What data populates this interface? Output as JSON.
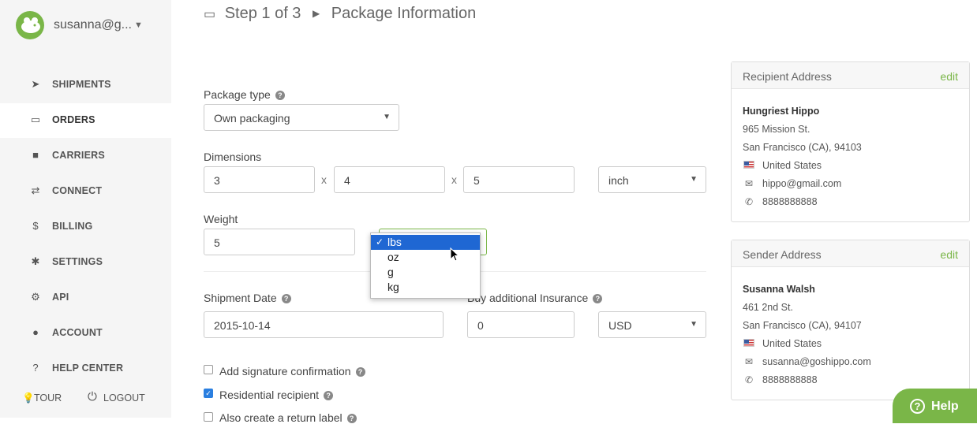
{
  "sidebar": {
    "user": "susanna@g...",
    "nav": [
      {
        "label": "SHIPMENTS",
        "icon": "paper-plane-icon"
      },
      {
        "label": "ORDERS",
        "icon": "inbox-icon"
      },
      {
        "label": "CARRIERS",
        "icon": "truck-icon"
      },
      {
        "label": "CONNECT",
        "icon": "exchange-icon"
      },
      {
        "label": "BILLING",
        "icon": "dollar-icon"
      },
      {
        "label": "SETTINGS",
        "icon": "gear-icon"
      },
      {
        "label": "API",
        "icon": "gears-icon"
      },
      {
        "label": "ACCOUNT",
        "icon": "user-icon"
      },
      {
        "label": "HELP CENTER",
        "icon": "question-icon"
      }
    ],
    "tour": "TOUR",
    "logout": "LOGOUT"
  },
  "header": {
    "step": "Step 1 of 3",
    "page": "Package Information"
  },
  "form": {
    "package_type_label": "Package type",
    "package_type_value": "Own packaging",
    "dimensions_label": "Dimensions",
    "dim_length": "3",
    "dim_width": "4",
    "dim_height": "5",
    "dim_sep": "x",
    "dim_unit": "inch",
    "weight_label": "Weight",
    "weight_value": "5",
    "weight_unit_options": [
      "lbs",
      "oz",
      "g",
      "kg"
    ],
    "weight_unit_selected": "lbs",
    "shipment_date_label": "Shipment Date",
    "shipment_date_value": "2015-10-14",
    "insurance_label": "Buy additional Insurance",
    "insurance_value": "0",
    "currency": "USD",
    "cb_signature": "Add signature confirmation",
    "cb_residential": "Residential recipient",
    "cb_return": "Also create a return label"
  },
  "recipient": {
    "title": "Recipient Address",
    "edit": "edit",
    "name": "Hungriest Hippo",
    "street": "965 Mission St.",
    "city": "San Francisco (CA), 94103",
    "country": "United States",
    "email": "hippo@gmail.com",
    "phone": "8888888888"
  },
  "sender": {
    "title": "Sender Address",
    "edit": "edit",
    "name": "Susanna Walsh",
    "street": "461 2nd St.",
    "city": "San Francisco (CA), 94107",
    "country": "United States",
    "email": "susanna@goshippo.com",
    "phone": "8888888888"
  },
  "help_button": "Help",
  "colors": {
    "brand": "#7ab648",
    "select_highlight": "#1f67d3"
  }
}
